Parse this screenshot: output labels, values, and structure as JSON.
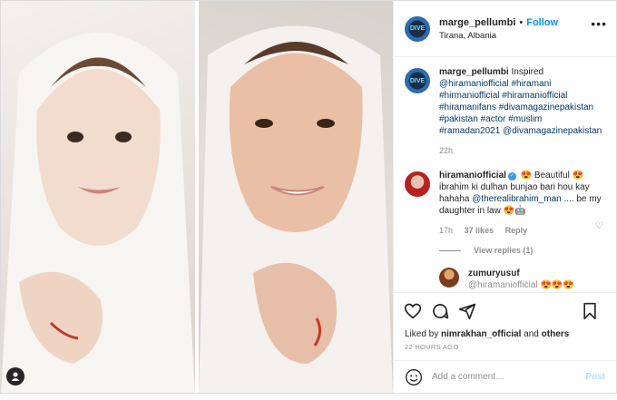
{
  "post": {
    "username": "marge_pellumbi",
    "follow_label": "Follow",
    "separator": "•",
    "location": "Tirana, Albania",
    "more_icon": "more-dots-icon"
  },
  "caption": {
    "username": "marge_pellumbi",
    "text": "Inspired",
    "tags": "@hiramaniofficial #hiramani #hirmaniofficial #hiramaniofficial #hiramanifans #divamagazinepakistan #pakistan #actor #muslim #ramadan2021 @divamagazinepakistan",
    "time": "22h"
  },
  "comment": {
    "username": "hiramaniofficial",
    "verified": "✓",
    "text_pre": " 😍 Beautiful 😍 ibrahim ki dulhan bunjao bari hou kay hahaha ",
    "mention": "@therealibrahim_man",
    "text_post": " .... be my daughter in law 😍🤖",
    "time": "17h",
    "likes": "37 likes",
    "reply": "Reply",
    "view_replies": "View replies (1)"
  },
  "reply": {
    "username": "zumuryusuf",
    "text": "@hiramaniofficial 😍😍😍"
  },
  "actions": {
    "liked_prefix": "Liked by ",
    "liked_user": "nimrakhan_official",
    "liked_mid": " and ",
    "liked_others": "others",
    "time_ago": "22 HOURS AGO"
  },
  "add_comment": {
    "placeholder": "Add a comment…",
    "post_label": "Post"
  },
  "avatar_text": "DIVE",
  "colors": {
    "accent": "#0095f6",
    "link": "#00376b",
    "muted": "#8e8e8e"
  }
}
